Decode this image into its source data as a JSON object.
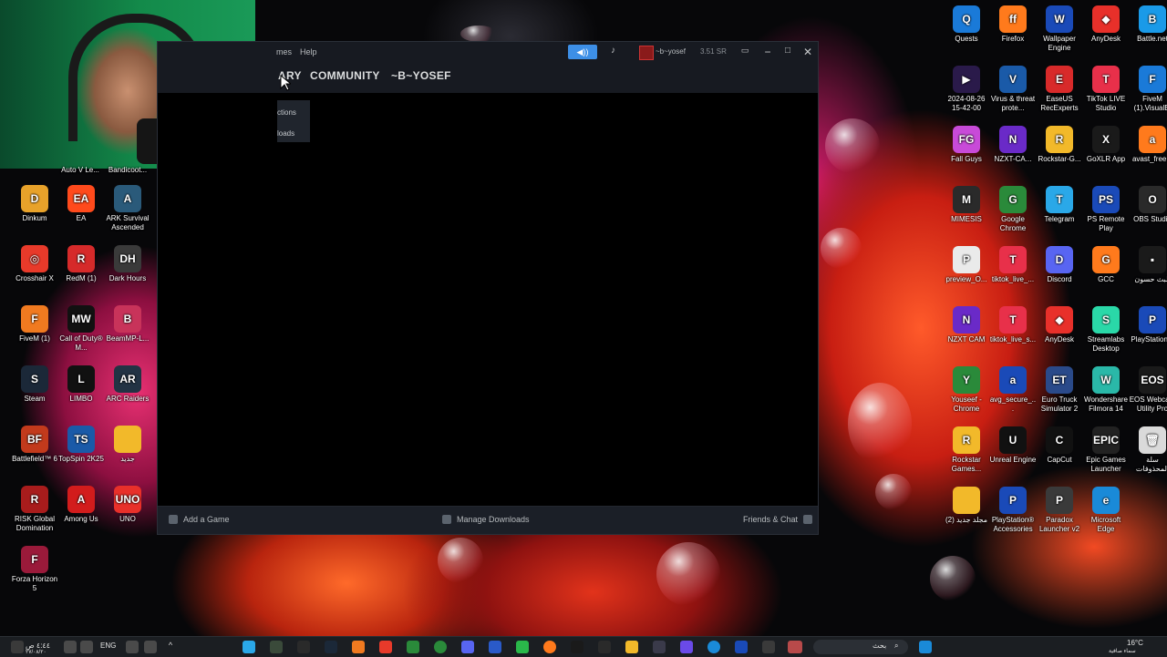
{
  "steam": {
    "menu_games": "mes",
    "menu_help": "Help",
    "nav_library": "ARY",
    "nav_community": "COMMUNITY",
    "nav_profile": "~B~YOSEF",
    "account_name": "~b~yosef",
    "wallet": "3.51 SR",
    "dropdown_item_1": "ctions",
    "dropdown_item_2": "loads",
    "footer_add_game": "Add a Game",
    "footer_manage_downloads": "Manage Downloads",
    "footer_friends_chat": "Friends & Chat"
  },
  "desktop_left": [
    {
      "label": "Auto V Le...",
      "color": "#2a2a2a",
      "glyph": ""
    },
    {
      "label": "Bandicoot...",
      "color": "#2a2a2a",
      "glyph": ""
    },
    {
      "label": "Dinkum",
      "color": "#e8a22a",
      "glyph": "D"
    },
    {
      "label": "EA",
      "color": "#ff4a1c",
      "glyph": "EA"
    },
    {
      "label": "ARK Survival Ascended",
      "color": "#2a5a7a",
      "glyph": "A"
    },
    {
      "label": "Crosshair X",
      "color": "#e83a2a",
      "glyph": "◎"
    },
    {
      "label": "RedM (1)",
      "color": "#d62a2a",
      "glyph": "R"
    },
    {
      "label": "Dark Hours",
      "color": "#3a3a3a",
      "glyph": "DH"
    },
    {
      "label": "FiveM (1)",
      "color": "#f07a20",
      "glyph": "F"
    },
    {
      "label": "Call of Duty® M...",
      "color": "#111111",
      "glyph": "MW"
    },
    {
      "label": "BeamMP-L...",
      "color": "#c8335a",
      "glyph": "B"
    },
    {
      "label": "Steam",
      "color": "#1b2838",
      "glyph": "S"
    },
    {
      "label": "LIMBO",
      "color": "#111111",
      "glyph": "L"
    },
    {
      "label": "ARC Raiders",
      "color": "#223344",
      "glyph": "AR"
    },
    {
      "label": "Battlefield™ 6",
      "color": "#c23a1c",
      "glyph": "BF"
    },
    {
      "label": "TopSpin 2K25",
      "color": "#1a5aa8",
      "glyph": "TS"
    },
    {
      "label": "جديد",
      "color": "#f2b92a",
      "glyph": ""
    },
    {
      "label": "RISK Global Domination",
      "color": "#a81c1c",
      "glyph": "R"
    },
    {
      "label": "Among Us",
      "color": "#d21c1c",
      "glyph": "A"
    },
    {
      "label": "UNO",
      "color": "#e8302a",
      "glyph": "UNO"
    },
    {
      "label": "Forza Horizon 5",
      "color": "#9a1a3a",
      "glyph": "F"
    }
  ],
  "desktop_right": [
    {
      "label": "Quests",
      "color": "#1a7ad8",
      "glyph": "Q"
    },
    {
      "label": "Firefox",
      "color": "#ff7a1c",
      "glyph": "ff"
    },
    {
      "label": "Wallpaper Engine",
      "color": "#1a4ab8",
      "glyph": "W"
    },
    {
      "label": "AnyDesk",
      "color": "#e8302a",
      "glyph": "◆"
    },
    {
      "label": "Battle.net",
      "color": "#1a9ae8",
      "glyph": "B"
    },
    {
      "label": "2024-08-26 15-42-00",
      "color": "#2a1a4a",
      "glyph": "▶"
    },
    {
      "label": "Virus & threat prote...",
      "color": "#1a5aa8",
      "glyph": "V"
    },
    {
      "label": "EaseUS RecExperts",
      "color": "#d82a2a",
      "glyph": "E"
    },
    {
      "label": "TikTok LIVE Studio",
      "color": "#e8304a",
      "glyph": "T"
    },
    {
      "label": "FiveM (1).VisualEl",
      "color": "#1a7ad8",
      "glyph": "F"
    },
    {
      "label": "Fall Guys",
      "color": "#c84ad8",
      "glyph": "FG"
    },
    {
      "label": "NZXT-CA...",
      "color": "#6a2ac8",
      "glyph": "N"
    },
    {
      "label": "Rockstar-G...",
      "color": "#f2b92a",
      "glyph": "R"
    },
    {
      "label": "GoXLR App",
      "color": "#1a1a1a",
      "glyph": "X"
    },
    {
      "label": "avast_free...",
      "color": "#ff7a1c",
      "glyph": "a"
    },
    {
      "label": "MIMESIS",
      "color": "#2a2a2a",
      "glyph": "M"
    },
    {
      "label": "Google Chrome",
      "color": "#2a8a3a",
      "glyph": "G"
    },
    {
      "label": "Telegram",
      "color": "#2aa8e8",
      "glyph": "T"
    },
    {
      "label": "PS Remote Play",
      "color": "#1a4ab8",
      "glyph": "PS"
    },
    {
      "label": "OBS Studio",
      "color": "#2a2a2a",
      "glyph": "O"
    },
    {
      "label": "preview_O...",
      "color": "#eaeaea",
      "glyph": "P"
    },
    {
      "label": "tiktok_live_...",
      "color": "#e8304a",
      "glyph": "T"
    },
    {
      "label": "Discord",
      "color": "#5865f2",
      "glyph": "D"
    },
    {
      "label": "GCC",
      "color": "#ff7a1c",
      "glyph": "G"
    },
    {
      "label": "البث حسون",
      "color": "#1a1a1a",
      "glyph": "▪"
    },
    {
      "label": "NZXT CAM",
      "color": "#6a2ac8",
      "glyph": "N"
    },
    {
      "label": "tiktok_live_s...",
      "color": "#e8304a",
      "glyph": "T"
    },
    {
      "label": "AnyDesk",
      "color": "#e8302a",
      "glyph": "◆"
    },
    {
      "label": "Streamlabs Desktop",
      "color": "#2ad8a8",
      "glyph": "S"
    },
    {
      "label": "PlayStation...",
      "color": "#1a4ab8",
      "glyph": "P"
    },
    {
      "label": "Youseef - Chrome",
      "color": "#2a8a3a",
      "glyph": "Y"
    },
    {
      "label": "avg_secure_...",
      "color": "#1a4ab8",
      "glyph": "a"
    },
    {
      "label": "Euro Truck Simulator 2",
      "color": "#2a4a8a",
      "glyph": "ET"
    },
    {
      "label": "Wondershare Filmora 14",
      "color": "#2ab8a8",
      "glyph": "W"
    },
    {
      "label": "EOS Webcam Utility Pro",
      "color": "#1a1a1a",
      "glyph": "EOS"
    },
    {
      "label": "Rockstar Games...",
      "color": "#f2b92a",
      "glyph": "R"
    },
    {
      "label": "Unreal Engine",
      "color": "#111111",
      "glyph": "U"
    },
    {
      "label": "CapCut",
      "color": "#111111",
      "glyph": "C"
    },
    {
      "label": "Epic Games Launcher",
      "color": "#222222",
      "glyph": "EPIC"
    },
    {
      "label": "سلة المحذوفات",
      "color": "#dadada",
      "glyph": "🗑"
    },
    {
      "label": "(2) مجلد جديد",
      "color": "#f2b92a",
      "glyph": ""
    },
    {
      "label": "PlayStation® Accessories",
      "color": "#1a4ab8",
      "glyph": "P"
    },
    {
      "label": "Paradox Launcher v2",
      "color": "#3a3a3a",
      "glyph": "P"
    },
    {
      "label": "Microsoft Edge",
      "color": "#1a8ad8",
      "glyph": "e"
    }
  ],
  "taskbar": {
    "time_left": "٤:٤٤ ص",
    "date_left": "٢٧/٠٨/٢٠",
    "lang": "ENG",
    "search_label": "بحث",
    "weather_temp": "16°C",
    "weather_desc": "سماء صافية"
  }
}
